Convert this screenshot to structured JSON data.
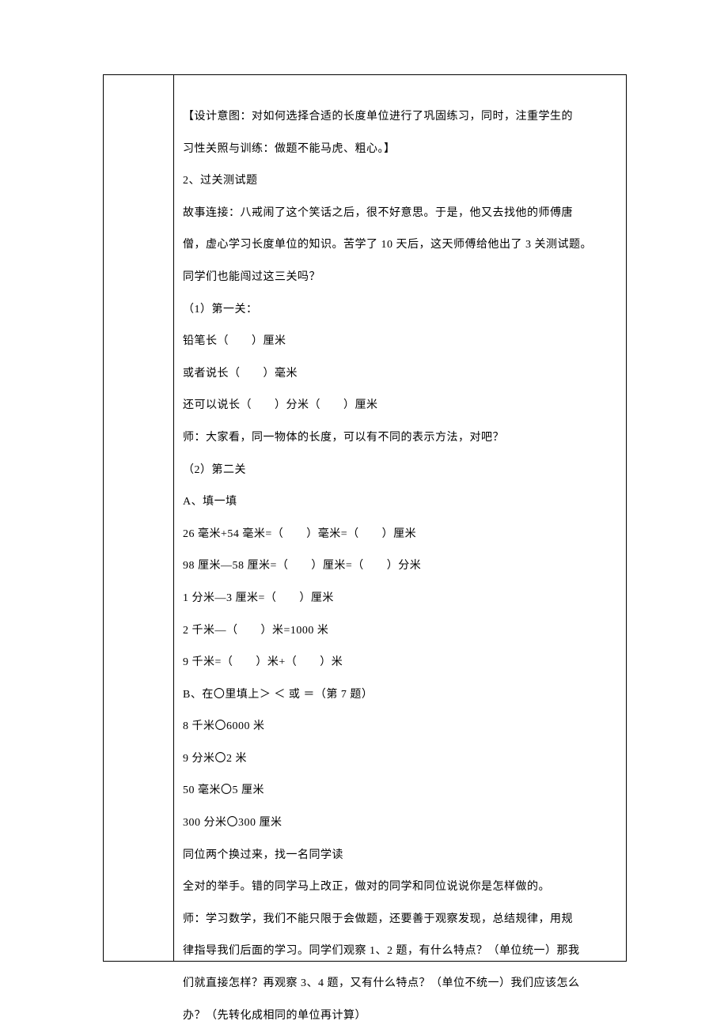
{
  "lines": [
    {
      "text": "【设计意图：对如何选择合适的长度单位进行了巩固练习，同时，注重学生的",
      "cls": ""
    },
    {
      "text": "习性关照与训练：做题不能马虎、粗心。】",
      "cls": ""
    },
    {
      "text": "2、过关测试题",
      "cls": ""
    },
    {
      "text": "故事连接：八戒闹了这个笑话之后，很不好意思。于是，他又去找他的师傅唐",
      "cls": ""
    },
    {
      "text": "僧，虚心学习长度单位的知识。苦学了 10 天后，这天师傅给他出了 3 关测试题。",
      "cls": ""
    },
    {
      "text": "同学们也能闯过这三关吗？",
      "cls": ""
    },
    {
      "text": "（1）第一关：",
      "cls": ""
    },
    {
      "text": "铅笔长（　　）厘米",
      "cls": ""
    },
    {
      "text": "或者说长（　　）毫米",
      "cls": ""
    },
    {
      "text": "还可以说长（　　）分米（　　）厘米",
      "cls": ""
    },
    {
      "text": "师：大家看，同一物体的长度，可以有不同的表示方法，对吧？",
      "cls": ""
    },
    {
      "text": "（2）第二关",
      "cls": ""
    },
    {
      "text": "A、填一填",
      "cls": ""
    },
    {
      "text": "26 毫米+54 毫米=（　　）毫米=（　　）厘米",
      "cls": ""
    },
    {
      "text": "98 厘米—58 厘米=（　　）厘米=（　　）分米",
      "cls": ""
    },
    {
      "text": "1 分米—3 厘米=（　　）厘米",
      "cls": ""
    },
    {
      "text": "2 千米—（　　）米=1000 米",
      "cls": ""
    },
    {
      "text": "9 千米=（　　）米+（　　）米",
      "cls": ""
    },
    {
      "text": "B、在〇里填上＞ ＜ 或 ＝（第 7 题）",
      "cls": ""
    },
    {
      "text": "8 千米〇6000 米",
      "cls": ""
    },
    {
      "text": "9 分米〇2 米",
      "cls": ""
    },
    {
      "text": "50 毫米〇5 厘米",
      "cls": ""
    },
    {
      "text": "300 分米〇300 厘米",
      "cls": ""
    },
    {
      "text": "同位两个换过来，找一名同学读",
      "cls": ""
    },
    {
      "text": "全对的举手。错的同学马上改正，做对的同学和同位说说你是怎样做的。",
      "cls": ""
    },
    {
      "text": "师：学习数学，我们不能只限于会做题，还要善于观察发现，总结规律，用规",
      "cls": ""
    },
    {
      "text": "律指导我们后面的学习。同学们观察 1、2 题，有什么特点？（单位统一）那我",
      "cls": ""
    },
    {
      "text": "们就直接怎样？再观察 3、4 题，又有什么特点？（单位不统一）我们应该怎么",
      "cls": ""
    },
    {
      "text": "办？（先转化成相同的单位再计算）",
      "cls": ""
    }
  ]
}
